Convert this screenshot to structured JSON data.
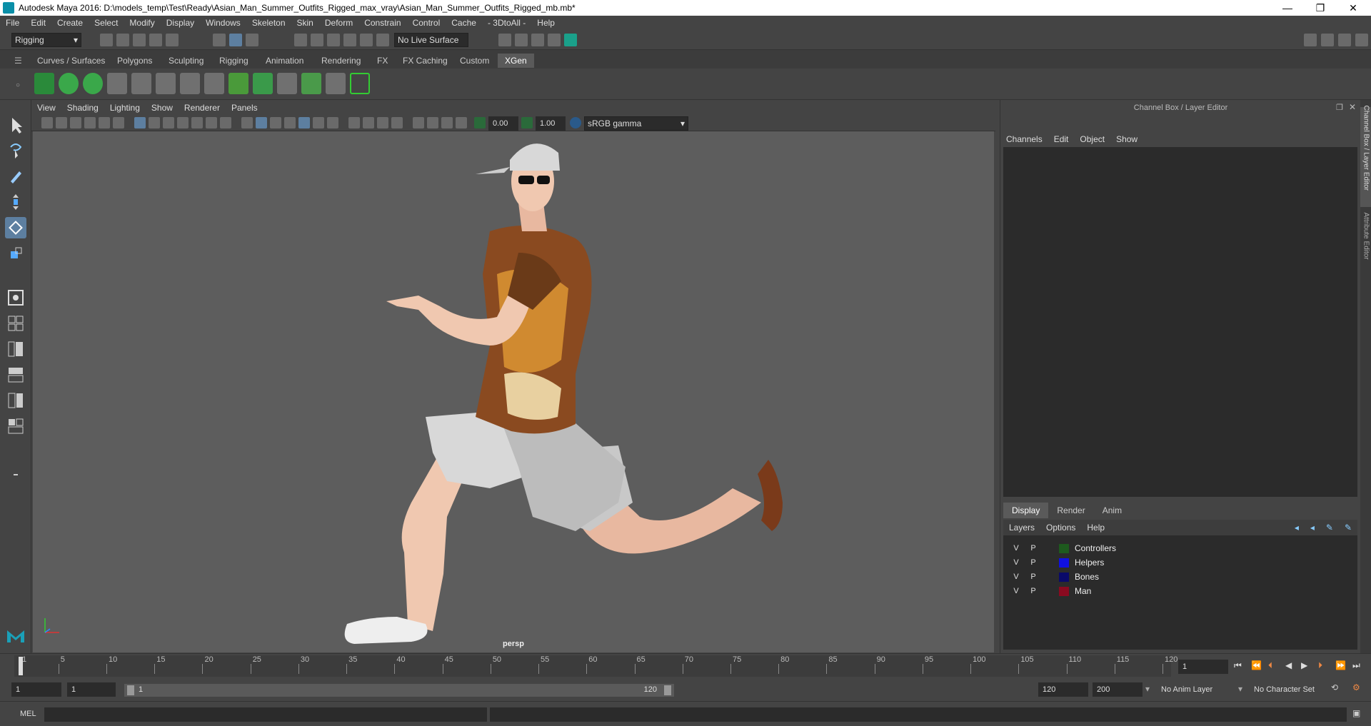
{
  "window": {
    "title": "Autodesk Maya 2016: D:\\models_temp\\Test\\Ready\\Asian_Man_Summer_Outfits_Rigged_max_vray\\Asian_Man_Summer_Outfits_Rigged_mb.mb*",
    "minimize": "—",
    "restore": "❐",
    "close": "✕"
  },
  "menubar": [
    "File",
    "Edit",
    "Create",
    "Select",
    "Modify",
    "Display",
    "Windows",
    "Skeleton",
    "Skin",
    "Deform",
    "Constrain",
    "Control",
    "Cache",
    "- 3DtoAll -",
    "Help"
  ],
  "statusline": {
    "menuset": "Rigging",
    "live_surface": "No Live Surface"
  },
  "shelf_tabs": [
    "Curves / Surfaces",
    "Polygons",
    "Sculpting",
    "Rigging",
    "Animation",
    "Rendering",
    "FX",
    "FX Caching",
    "Custom",
    "XGen"
  ],
  "active_shelf_tab": "XGen",
  "viewport": {
    "menu": [
      "View",
      "Shading",
      "Lighting",
      "Show",
      "Renderer",
      "Panels"
    ],
    "exposure": "0.00",
    "gamma": "1.00",
    "color_space": "sRGB gamma",
    "camera_label": "persp"
  },
  "channel_box": {
    "title": "Channel Box / Layer Editor",
    "menu": [
      "Channels",
      "Edit",
      "Object",
      "Show"
    ]
  },
  "side_tabs": [
    "Channel Box / Layer Editor",
    "Attribute Editor"
  ],
  "layer_editor": {
    "tabs": [
      "Display",
      "Render",
      "Anim"
    ],
    "active_tab": "Display",
    "menu": [
      "Layers",
      "Options",
      "Help"
    ],
    "layers": [
      {
        "v": "V",
        "p": "P",
        "name": "Controllers",
        "color": "#1e5a1e"
      },
      {
        "v": "V",
        "p": "P",
        "name": "Helpers",
        "color": "#1010e0"
      },
      {
        "v": "V",
        "p": "P",
        "name": "Bones",
        "color": "#0a0a6a"
      },
      {
        "v": "V",
        "p": "P",
        "name": "Man",
        "color": "#8a0a20"
      }
    ]
  },
  "timeline": {
    "ticks": [
      "1",
      "5",
      "10",
      "15",
      "20",
      "25",
      "30",
      "35",
      "40",
      "45",
      "50",
      "55",
      "60",
      "65",
      "70",
      "75",
      "80",
      "85",
      "90",
      "95",
      "100",
      "105",
      "110",
      "115",
      "120"
    ],
    "current_frame": "1"
  },
  "range": {
    "start": "1",
    "playback_start": "1",
    "slider_start": "1",
    "slider_end": "120",
    "playback_end": "120",
    "end": "200",
    "anim_layer": "No Anim Layer",
    "character_set": "No Character Set"
  },
  "command_line": {
    "label": "MEL"
  }
}
